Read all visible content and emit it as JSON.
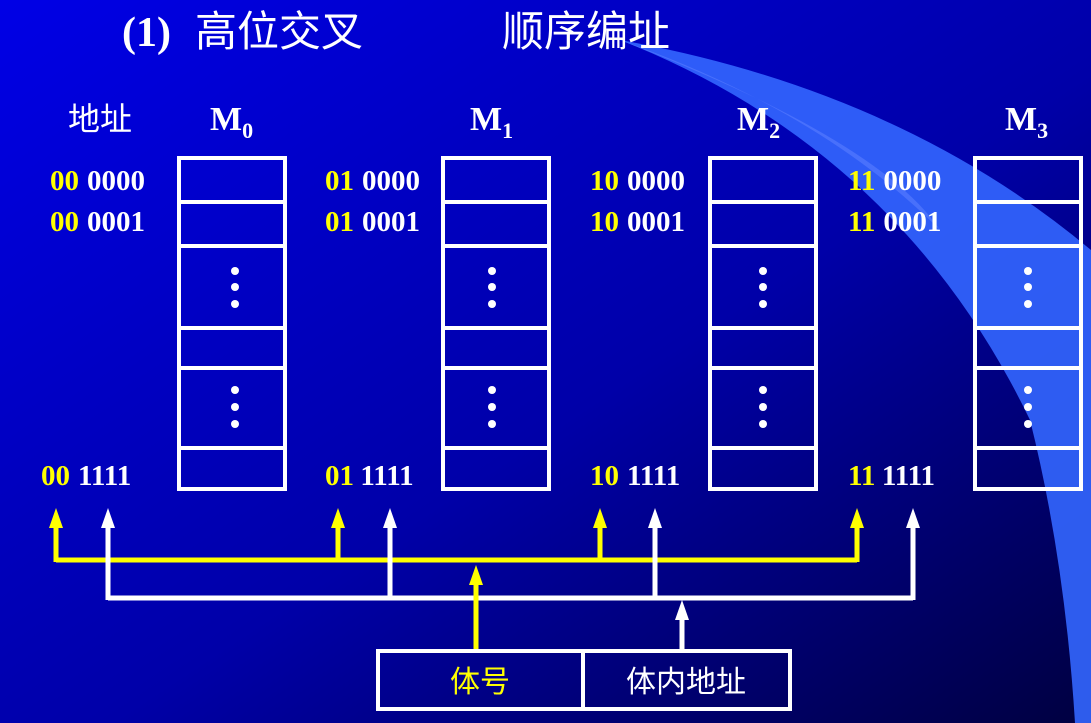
{
  "title": {
    "number": "(1)",
    "scheme": "高位交叉",
    "addressing": "顺序编址"
  },
  "address_header": "地址",
  "modules": [
    {
      "name": "M",
      "sub": "0",
      "bank": "00",
      "addrs": [
        "0000",
        "0001",
        "1111"
      ]
    },
    {
      "name": "M",
      "sub": "1",
      "bank": "01",
      "addrs": [
        "0000",
        "0001",
        "1111"
      ]
    },
    {
      "name": "M",
      "sub": "2",
      "bank": "10",
      "addrs": [
        "0000",
        "0001",
        "1111"
      ]
    },
    {
      "name": "M",
      "sub": "3",
      "bank": "11",
      "addrs": [
        "0000",
        "0001",
        "1111"
      ]
    }
  ],
  "address_register": {
    "bank_field": "体号",
    "offset_field": "体内地址"
  },
  "colors": {
    "bank_bits": "#ffff00",
    "offset_bits": "#ffffff",
    "background": "#0000c8",
    "accent_band": "#3366ff"
  }
}
